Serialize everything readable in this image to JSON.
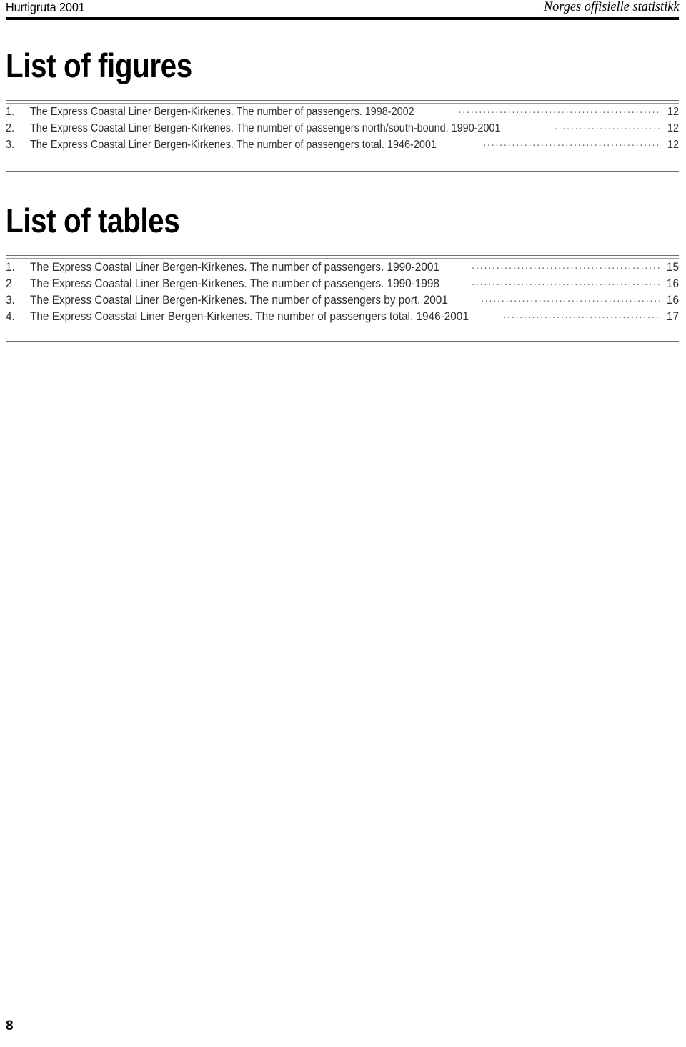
{
  "header": {
    "left_title": "Hurtigruta 2001",
    "right_title": "Norges offisielle statistikk"
  },
  "figures": {
    "heading": "List of figures",
    "items": [
      {
        "number": "1.",
        "text": "The Express Coastal Liner Bergen-Kirkenes. The number of passengers. 1998-2002",
        "page": "12"
      },
      {
        "number": "2.",
        "text": "The Express Coastal Liner Bergen-Kirkenes. The number of passengers north/south-bound. 1990-2001",
        "page": "12"
      },
      {
        "number": "3.",
        "text": "The Express Coastal Liner Bergen-Kirkenes. The number of passengers total. 1946-2001",
        "page": "12"
      }
    ]
  },
  "tables": {
    "heading": "List of tables",
    "items": [
      {
        "number": "1.",
        "text": "The Express Coastal Liner Bergen-Kirkenes. The number of passengers. 1990-2001",
        "page": "15"
      },
      {
        "number": "2",
        "text": "The Express Coastal Liner Bergen-Kirkenes. The number of passengers. 1990-1998",
        "page": "16"
      },
      {
        "number": "3.",
        "text": "The Express Coastal Liner Bergen-Kirkenes. The number of passengers by port. 2001",
        "page": "16"
      },
      {
        "number": "4.",
        "text": "The Express Coasstal Liner Bergen-Kirkenes. The number of passengers total. 1946-2001",
        "page": "17"
      }
    ]
  },
  "footer": {
    "page_number": "8"
  }
}
